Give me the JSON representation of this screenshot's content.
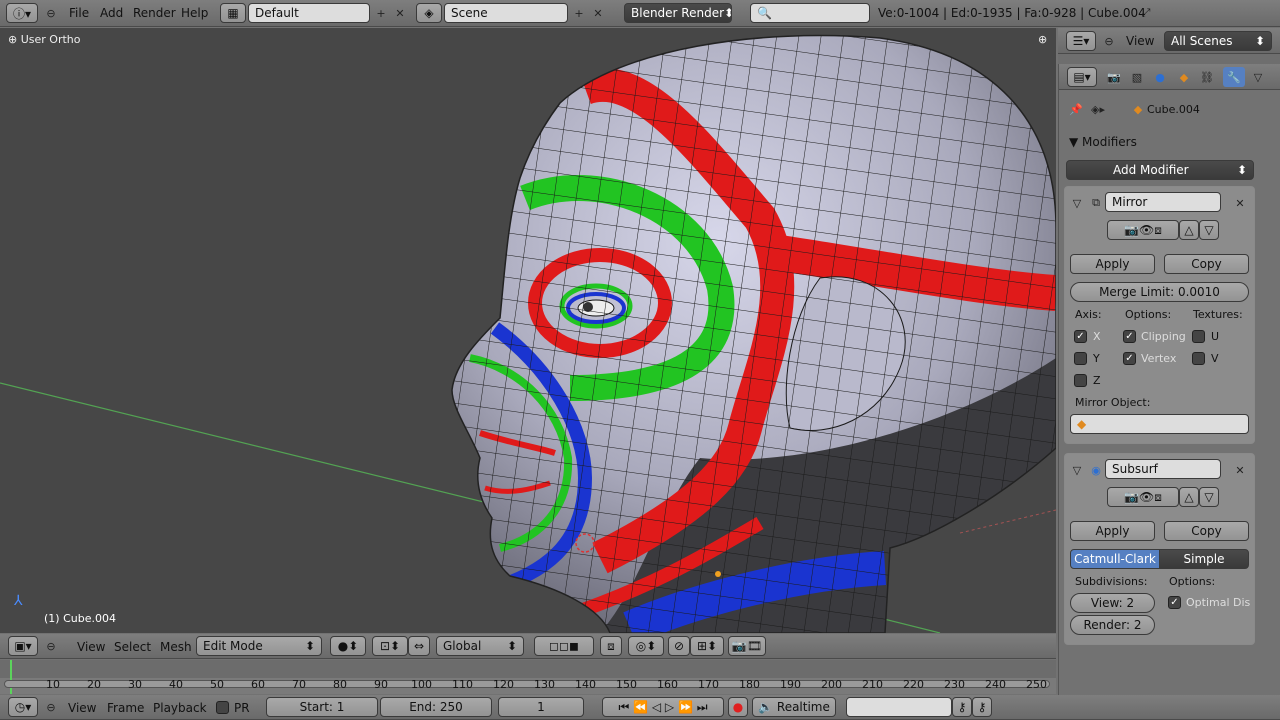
{
  "top_header": {
    "menu": [
      "File",
      "Add",
      "Render",
      "Help"
    ],
    "layout": "Default",
    "scene": "Scene",
    "engine": "Blender Render",
    "stats": "Ve:0-1004 | Ed:0-1935 | Fa:0-928 | Cube.004"
  },
  "viewport": {
    "view_name": "User Ortho",
    "object_label": "(1) Cube.004"
  },
  "view3d_header": {
    "menus": [
      "View",
      "Select",
      "Mesh"
    ],
    "mode": "Edit Mode",
    "orientation": "Global"
  },
  "timeline": {
    "ticks": [
      "10",
      "20",
      "30",
      "40",
      "50",
      "60",
      "70",
      "80",
      "90",
      "100",
      "110",
      "120",
      "130",
      "140",
      "150",
      "160",
      "170",
      "180",
      "190",
      "200",
      "210",
      "220",
      "230",
      "240",
      "250"
    ],
    "menus": [
      "View",
      "Frame",
      "Playback"
    ],
    "pr": "PR",
    "start": "Start: 1",
    "end": "End: 250",
    "current": "1",
    "sync": "Realtime"
  },
  "outliner": {
    "view": "View",
    "scenes": "All Scenes"
  },
  "properties": {
    "object": "Cube.004",
    "section": "Modifiers",
    "add_modifier": "Add Modifier",
    "mirror": {
      "name": "Mirror",
      "apply": "Apply",
      "copy": "Copy",
      "merge": "Merge Limit: 0.0010",
      "axis": "Axis:",
      "options": "Options:",
      "textures": "Textures:",
      "x": "X",
      "y": "Y",
      "z": "Z",
      "clipping": "Clipping",
      "vertex": "Vertex",
      "u": "U",
      "v": "V",
      "mirror_object": "Mirror Object:"
    },
    "subsurf": {
      "name": "Subsurf",
      "apply": "Apply",
      "copy": "Copy",
      "catmull": "Catmull-Clark",
      "simple": "Simple",
      "subdivisions": "Subdivisions:",
      "options": "Options:",
      "view": "View: 2",
      "render": "Render: 2",
      "optimal": "Optimal Dis"
    }
  },
  "colors": {
    "accent": "#5680c2",
    "red": "#e01a1a",
    "green": "#22c422",
    "blue": "#1a34d0"
  }
}
